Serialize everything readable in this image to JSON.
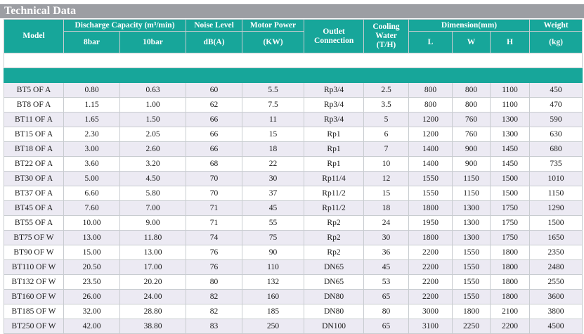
{
  "title": "Technical Data",
  "headers": {
    "model": "Model",
    "discharge": "Discharge Capacity (m³/min)",
    "noise": "Noise Level",
    "motor": "Motor Power",
    "outlet": "Outlet Connection",
    "cooling": "Cooling Water (T/H)",
    "dimension": "Dimension(mm)",
    "weight": "Weight",
    "bar8": "8bar",
    "bar10": "10bar",
    "dba": "dB(A)",
    "kw": "(KW)",
    "l": "L",
    "w": "W",
    "h": "H",
    "kg": "(kg)"
  },
  "rows": [
    [
      "BT5 OF A",
      "0.80",
      "0.63",
      "60",
      "5.5",
      "Rp3/4",
      "2.5",
      "800",
      "800",
      "1100",
      "450"
    ],
    [
      "BT8 OF A",
      "1.15",
      "1.00",
      "62",
      "7.5",
      "Rp3/4",
      "3.5",
      "800",
      "800",
      "1100",
      "470"
    ],
    [
      "BT11 OF A",
      "1.65",
      "1.50",
      "66",
      "11",
      "Rp3/4",
      "5",
      "1200",
      "760",
      "1300",
      "590"
    ],
    [
      "BT15 OF A",
      "2.30",
      "2.05",
      "66",
      "15",
      "Rp1",
      "6",
      "1200",
      "760",
      "1300",
      "630"
    ],
    [
      "BT18 OF A",
      "3.00",
      "2.60",
      "66",
      "18",
      "Rp1",
      "7",
      "1400",
      "900",
      "1450",
      "680"
    ],
    [
      "BT22 OF A",
      "3.60",
      "3.20",
      "68",
      "22",
      "Rp1",
      "10",
      "1400",
      "900",
      "1450",
      "735"
    ],
    [
      "BT30 OF A",
      "5.00",
      "4.50",
      "70",
      "30",
      "Rp11/4",
      "12",
      "1550",
      "1150",
      "1500",
      "1010"
    ],
    [
      "BT37 OF A",
      "6.60",
      "5.80",
      "70",
      "37",
      "Rp11/2",
      "15",
      "1550",
      "1150",
      "1500",
      "1150"
    ],
    [
      "BT45 OF A",
      "7.60",
      "7.00",
      "71",
      "45",
      "Rp11/2",
      "18",
      "1800",
      "1300",
      "1750",
      "1290"
    ],
    [
      "BT55 OF A",
      "10.00",
      "9.00",
      "71",
      "55",
      "Rp2",
      "24",
      "1950",
      "1300",
      "1750",
      "1500"
    ],
    [
      "BT75 OF W",
      "13.00",
      "11.80",
      "74",
      "75",
      "Rp2",
      "30",
      "1800",
      "1300",
      "1750",
      "1650"
    ],
    [
      "BT90 OF W",
      "15.00",
      "13.00",
      "76",
      "90",
      "Rp2",
      "36",
      "2200",
      "1550",
      "1800",
      "2350"
    ],
    [
      "BT110 OF W",
      "20.50",
      "17.00",
      "76",
      "110",
      "DN65",
      "45",
      "2200",
      "1550",
      "1800",
      "2480"
    ],
    [
      "BT132 OF W",
      "23.50",
      "20.20",
      "80",
      "132",
      "DN65",
      "53",
      "2200",
      "1550",
      "1800",
      "2550"
    ],
    [
      "BT160 OF W",
      "26.00",
      "24.00",
      "82",
      "160",
      "DN80",
      "65",
      "2200",
      "1550",
      "1800",
      "3600"
    ],
    [
      "BT185 OF W",
      "32.00",
      "28.80",
      "82",
      "185",
      "DN80",
      "80",
      "3000",
      "1800",
      "2100",
      "3800"
    ],
    [
      "BT250 OF W",
      "42.00",
      "38.80",
      "83",
      "250",
      "DN100",
      "65",
      "3100",
      "2250",
      "2200",
      "4500"
    ]
  ]
}
